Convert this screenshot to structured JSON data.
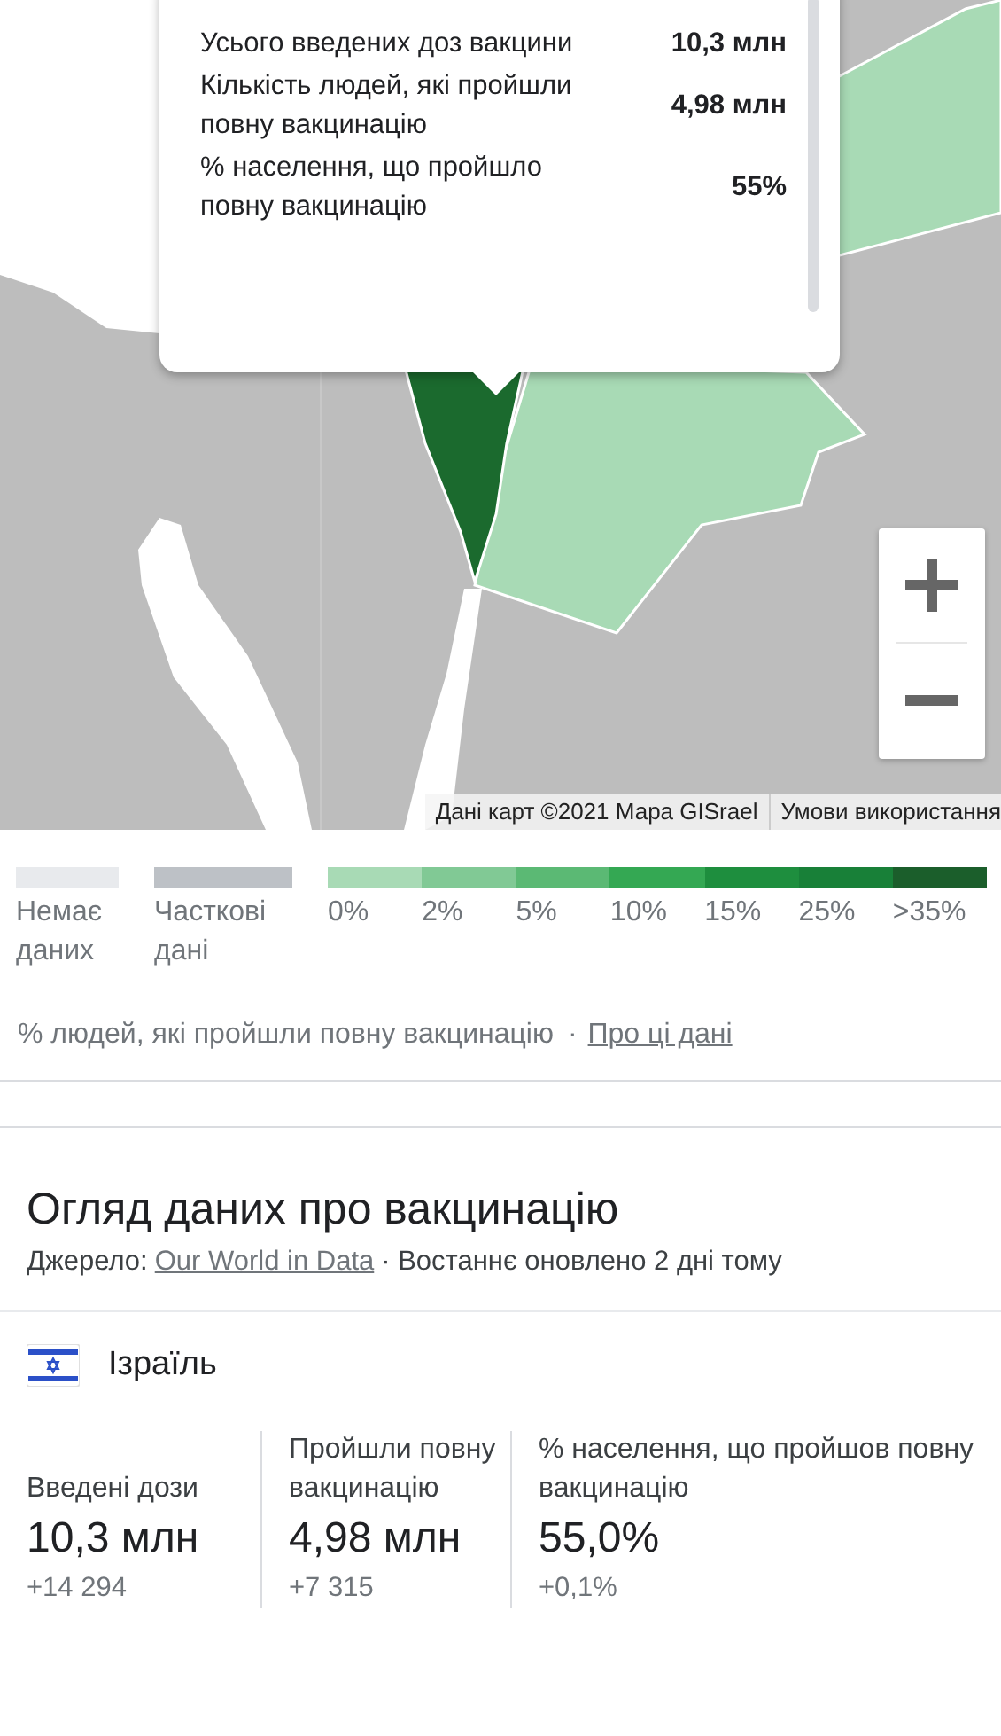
{
  "map": {
    "tooltip": {
      "rows": [
        {
          "label": "Усього введених доз вакцини",
          "value": "10,3 млн"
        },
        {
          "label": "Кількість людей, які пройшли повну вакцинацію",
          "value": "4,98 млн"
        },
        {
          "label": "% населення, що пройшло повну вакцинацію",
          "value": "55%"
        }
      ]
    },
    "attribution": [
      "Дані карт ©2021 Мара GISrael",
      "Умови використання"
    ]
  },
  "legend": {
    "items": [
      {
        "kind": "category",
        "label": "Немає даних",
        "color": "#e8eaed"
      },
      {
        "kind": "category",
        "label": "Часткові дані",
        "color": "#bdc1c6"
      },
      {
        "kind": "scale",
        "label": "0%",
        "color": "#a8dab5"
      },
      {
        "kind": "scale",
        "label": "2%",
        "color": "#81c995"
      },
      {
        "kind": "scale",
        "label": "5%",
        "color": "#5bb974"
      },
      {
        "kind": "scale",
        "label": "10%",
        "color": "#34a853"
      },
      {
        "kind": "scale",
        "label": "15%",
        "color": "#1e8e3e"
      },
      {
        "kind": "scale",
        "label": "25%",
        "color": "#188038"
      },
      {
        "kind": "scale",
        "label": ">35%",
        "color": "#1b5e2b"
      }
    ],
    "caption": "% людей, які пройшли повну вакцинацію",
    "separator": "·",
    "link": "Про ці дані"
  },
  "overview": {
    "title": "Огляд даних про вакцинацію",
    "source_label": "Джерело:",
    "source_link": "Our World in Data",
    "updated": "· Востаннє оновлено 2 дні тому"
  },
  "country": {
    "name": "Ізраїль",
    "stats": [
      {
        "label": "Введені дози",
        "value": "10,3 млн",
        "change": "+14 294"
      },
      {
        "label": "Пройшли повну вакцинацію",
        "value": "4,98 млн",
        "change": "+7 315"
      },
      {
        "label": "% населення, що пройшов повну вакцинацію",
        "value": "55,0%",
        "change": "+0,1%"
      }
    ]
  }
}
